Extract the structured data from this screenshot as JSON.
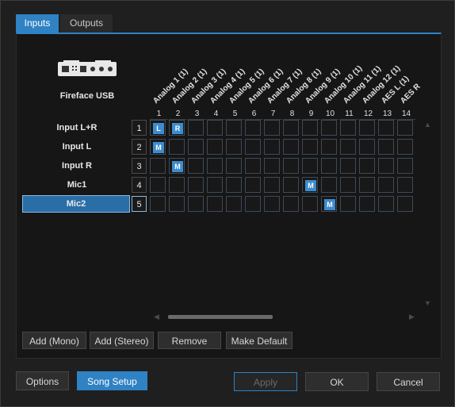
{
  "tabs": [
    {
      "label": "Inputs",
      "active": true
    },
    {
      "label": "Outputs",
      "active": false
    }
  ],
  "device": {
    "name": "Fireface USB",
    "icon": "audio-interface-icon"
  },
  "columns": [
    "Analog 1 (1)",
    "Analog 2 (1)",
    "Analog 3 (1)",
    "Analog 4 (1)",
    "Analog 5 (1)",
    "Analog 6 (1)",
    "Analog 7 (1)",
    "Analog 8 (1)",
    "Analog 9 (1)",
    "Analog 10 (1)",
    "Analog 11 (1)",
    "Analog 12 (1)",
    "AES L (1)",
    "AES R"
  ],
  "column_numbers": [
    "1",
    "2",
    "3",
    "4",
    "5",
    "6",
    "7",
    "8",
    "9",
    "10",
    "11",
    "12",
    "13",
    "14"
  ],
  "channels": [
    {
      "label": "Input L+R",
      "number": "1",
      "selected": false
    },
    {
      "label": "Input L",
      "number": "2",
      "selected": false
    },
    {
      "label": "Input R",
      "number": "3",
      "selected": false
    },
    {
      "label": "Mic1",
      "number": "4",
      "selected": false
    },
    {
      "label": "Mic2",
      "number": "5",
      "selected": true
    }
  ],
  "assignments": [
    {
      "row": 0,
      "col": 0,
      "text": "L"
    },
    {
      "row": 0,
      "col": 1,
      "text": "R"
    },
    {
      "row": 1,
      "col": 0,
      "text": "M"
    },
    {
      "row": 2,
      "col": 1,
      "text": "M"
    },
    {
      "row": 3,
      "col": 8,
      "text": "M"
    },
    {
      "row": 4,
      "col": 9,
      "text": "M"
    }
  ],
  "panel_buttons": {
    "add_mono": "Add (Mono)",
    "add_stereo": "Add (Stereo)",
    "remove": "Remove",
    "make_default": "Make Default"
  },
  "footer_buttons": {
    "options": "Options",
    "song_setup": "Song Setup",
    "apply": "Apply",
    "ok": "OK",
    "cancel": "Cancel"
  },
  "glyphs": {
    "up": "▲",
    "down": "▼",
    "left": "◀",
    "right": "▶"
  },
  "colors": {
    "accent": "#2f82c4",
    "assignment": "#3d8ccf",
    "selected_row": "#2a6ea8"
  }
}
